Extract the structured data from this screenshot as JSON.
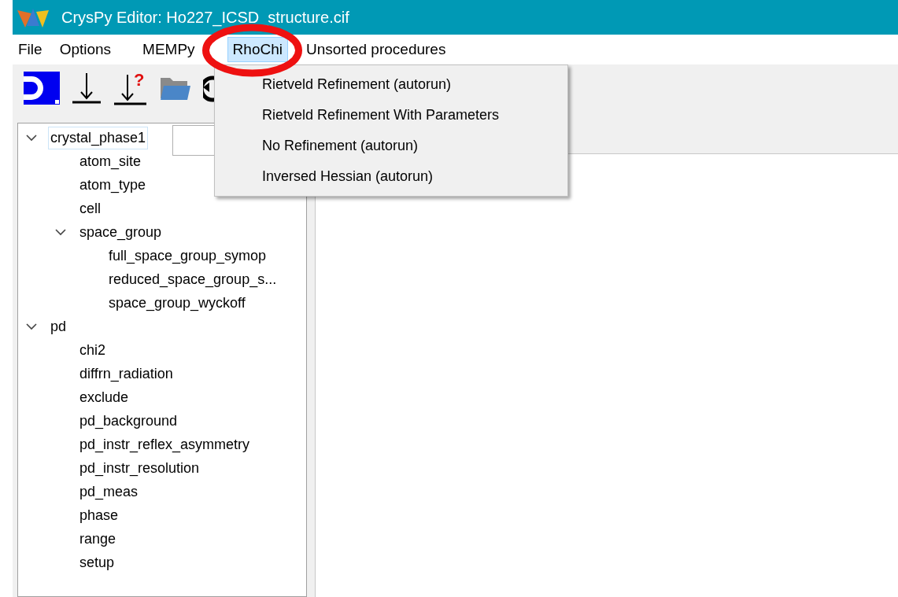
{
  "window": {
    "title": "CrysPy Editor: Ho227_ICSD_structure.cif"
  },
  "menu_bar": [
    {
      "label": "File",
      "selected": false
    },
    {
      "label": "Options",
      "selected": false
    },
    {
      "label": "MEMPy",
      "selected": false
    },
    {
      "label": "RhoChi",
      "selected": true
    },
    {
      "label": "Unsorted procedures",
      "selected": false
    }
  ],
  "toolbar": [
    {
      "kind": "d-logo"
    },
    {
      "kind": "arrow-down"
    },
    {
      "kind": "arrow-help",
      "mark": "?"
    },
    {
      "kind": "folder"
    },
    {
      "kind": "refresh"
    }
  ],
  "dropdown_menu": {
    "items": [
      "Rietveld Refinement (autorun)",
      "Rietveld Refinement With Parameters",
      "No Refinement (autorun)",
      "Inversed Hessian (autorun)"
    ]
  },
  "tree": [
    {
      "label": "crystal_phase1",
      "selected": true,
      "expanded": true,
      "children": [
        {
          "label": "atom_site",
          "selected": false
        },
        {
          "label": "atom_type",
          "selected": false
        },
        {
          "label": "cell",
          "selected": false
        },
        {
          "label": "space_group",
          "selected": false,
          "expanded": true,
          "children": [
            {
              "label": "full_space_group_symop",
              "selected": false
            },
            {
              "label": "reduced_space_group_s...",
              "selected": false
            },
            {
              "label": "space_group_wyckoff",
              "selected": false
            }
          ]
        }
      ]
    },
    {
      "label": "pd",
      "selected": false,
      "expanded": true,
      "children": [
        {
          "label": "chi2",
          "selected": false
        },
        {
          "label": "diffrn_radiation",
          "selected": false
        },
        {
          "label": "exclude",
          "selected": false
        },
        {
          "label": "pd_background",
          "selected": false
        },
        {
          "label": "pd_instr_reflex_asymmetry",
          "selected": false
        },
        {
          "label": "pd_instr_resolution",
          "selected": false
        },
        {
          "label": "pd_meas",
          "selected": false
        },
        {
          "label": "phase",
          "selected": false
        },
        {
          "label": "range",
          "selected": false
        },
        {
          "label": "setup",
          "selected": false
        }
      ]
    }
  ]
}
